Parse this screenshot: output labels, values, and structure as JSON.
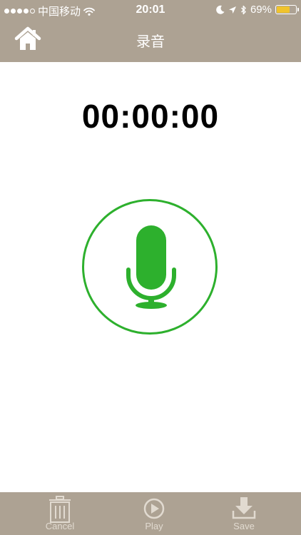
{
  "status_bar": {
    "carrier": "中国移动",
    "time": "20:01",
    "battery_percent": "69%",
    "battery_level": 0.69,
    "battery_color": "#f0c32c",
    "icons": [
      "signal-dots-icon",
      "wifi-icon",
      "moon-icon",
      "location-arrow-icon",
      "bluetooth-icon",
      "battery-icon"
    ]
  },
  "nav": {
    "title": "录音",
    "home_icon": "home-icon"
  },
  "recorder": {
    "elapsed": "00:00:00",
    "mic_icon": "microphone-icon",
    "accent_color": "#2db02d"
  },
  "toolbar": {
    "background": "#ada293",
    "cancel_label": "Cancel",
    "cancel_icon": "trash-icon",
    "play_label": "Play",
    "play_icon": "play-circle-icon",
    "save_label": "Save",
    "save_icon": "download-tray-icon"
  }
}
